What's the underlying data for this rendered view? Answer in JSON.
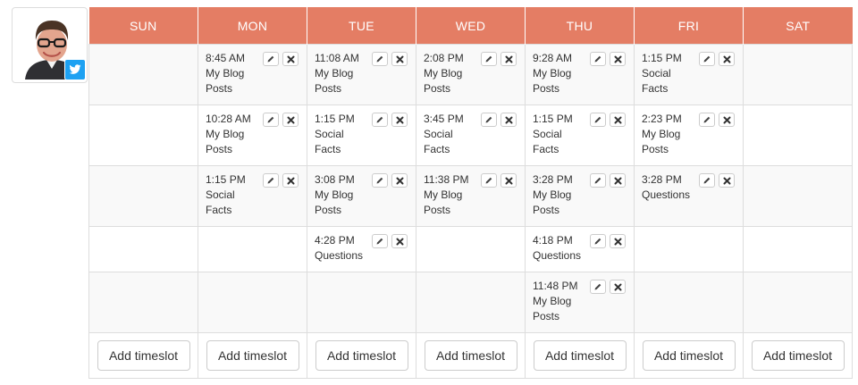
{
  "profile": {
    "network_icon": "twitter-icon",
    "network_color": "#1da1f2"
  },
  "colors": {
    "header_bg": "#e47d64",
    "header_text": "#ffffff",
    "row_stripe": "#f9f9f9",
    "border": "#dddddd"
  },
  "days": [
    "SUN",
    "MON",
    "TUE",
    "WED",
    "THU",
    "FRI",
    "SAT"
  ],
  "slots": {
    "mon": [
      {
        "time": "8:45 AM",
        "label": "My Blog Posts"
      },
      {
        "time": "10:28 AM",
        "label": "My Blog Posts"
      },
      {
        "time": "1:15 PM",
        "label": "Social Facts"
      }
    ],
    "tue": [
      {
        "time": "11:08 AM",
        "label": "My Blog Posts"
      },
      {
        "time": "1:15 PM",
        "label": "Social Facts"
      },
      {
        "time": "3:08 PM",
        "label": "My Blog Posts"
      },
      {
        "time": "4:28 PM",
        "label": "Questions"
      }
    ],
    "wed": [
      {
        "time": "2:08 PM",
        "label": "My Blog Posts"
      },
      {
        "time": "3:45 PM",
        "label": "Social Facts"
      },
      {
        "time": "11:38 PM",
        "label": "My Blog Posts"
      }
    ],
    "thu": [
      {
        "time": "9:28 AM",
        "label": "My Blog Posts"
      },
      {
        "time": "1:15 PM",
        "label": "Social Facts"
      },
      {
        "time": "3:28 PM",
        "label": "My Blog Posts"
      },
      {
        "time": "4:18 PM",
        "label": "Questions"
      },
      {
        "time": "11:48 PM",
        "label": "My Blog Posts"
      }
    ],
    "fri": [
      {
        "time": "1:15 PM",
        "label": "Social Facts"
      },
      {
        "time": "2:23 PM",
        "label": "My Blog Posts"
      },
      {
        "time": "3:28 PM",
        "label": "Questions"
      }
    ]
  },
  "slot_actions": {
    "edit_icon": "pencil-icon",
    "delete_icon": "close-icon"
  },
  "add_timeslot_label": "Add timeslot"
}
